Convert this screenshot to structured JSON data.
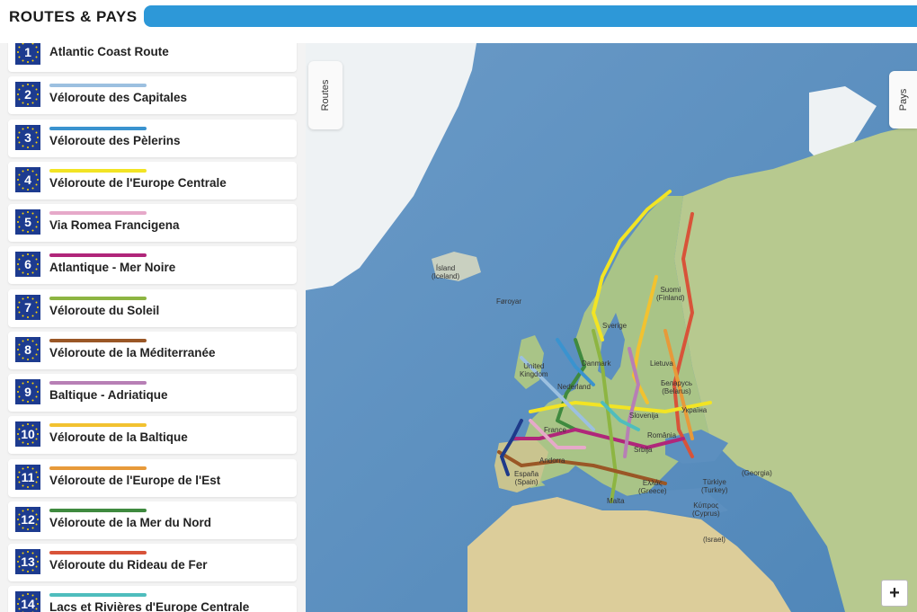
{
  "header": {
    "title": "ROUTES & PAYS"
  },
  "routes": [
    {
      "num": "1",
      "name": "Atlantic Coast Route",
      "color": "#1e3a8a"
    },
    {
      "num": "2",
      "name": "Véloroute des Capitales",
      "color": "#9cc0e0"
    },
    {
      "num": "3",
      "name": "Véloroute des Pèlerins",
      "color": "#3a93cf"
    },
    {
      "num": "4",
      "name": "Véloroute de l'Europe Centrale",
      "color": "#f2e424"
    },
    {
      "num": "5",
      "name": "Via Romea Francigena",
      "color": "#e6a9c9"
    },
    {
      "num": "6",
      "name": "Atlantique - Mer Noire",
      "color": "#b0267a"
    },
    {
      "num": "7",
      "name": "Véloroute du Soleil",
      "color": "#8db542"
    },
    {
      "num": "8",
      "name": "Véloroute de la Méditerranée",
      "color": "#9a5726"
    },
    {
      "num": "9",
      "name": "Baltique - Adriatique",
      "color": "#b77fb5"
    },
    {
      "num": "10",
      "name": "Véloroute de la Baltique",
      "color": "#f2c230"
    },
    {
      "num": "11",
      "name": "Véloroute de l'Europe de l'Est",
      "color": "#e79a3a"
    },
    {
      "num": "12",
      "name": "Véloroute de la Mer du Nord",
      "color": "#3f8a3f"
    },
    {
      "num": "13",
      "name": "Véloroute du Rideau de Fer",
      "color": "#d85339"
    },
    {
      "num": "14",
      "name": "Lacs et Rivières d'Europe Centrale",
      "color": "#4fbdbd"
    }
  ],
  "tabs": {
    "routes": "Routes",
    "pays": "Pays"
  },
  "map": {
    "zoom_in": "+",
    "labels": {
      "island": "Ísland\n(Iceland)",
      "foroyar": "Føroyar",
      "suomi": "Suomi\n(Finland)",
      "sverige": "Sverige",
      "danmark": "Danmark",
      "lietuva": "Lietuva",
      "belarus": "Беларусь\n(Belarus)",
      "ukraina": "Україна",
      "uk": "United\nKingdom",
      "nederland": "Nederland",
      "france": "France",
      "andorra": "Andorra",
      "espana": "España\n(Spain)",
      "romania": "România",
      "turkiye": "Türkiye\n(Turkey)",
      "georgia": "(Georgia)",
      "kypros": "Κύπρος\n(Cyprus)",
      "israel": "(Israel)",
      "malta": "Malta",
      "ellas": "Ελλάς\n(Greece)",
      "srbija": "Srbija",
      "slovenija": "Slovenija"
    }
  }
}
